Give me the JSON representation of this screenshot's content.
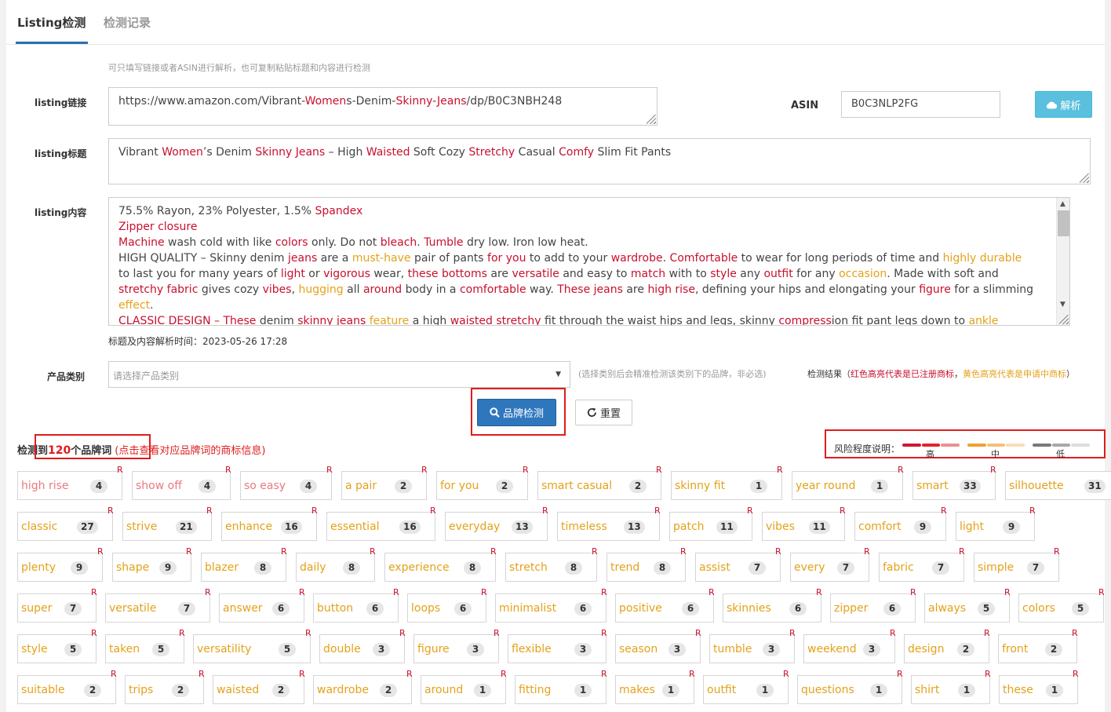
{
  "tabs": [
    "Listing检测",
    "检测记录"
  ],
  "hint": "可只填写链接或者ASIN进行解析，也可复制粘贴标题和内容进行检测",
  "link": {
    "label": "listing链接",
    "parts": [
      {
        "t": "https://www.amazon.com/Vibrant-",
        "c": ""
      },
      {
        "t": "Women",
        "c": "r"
      },
      {
        "t": "s-Denim-",
        "c": ""
      },
      {
        "t": "Skinny-Jeans",
        "c": "r"
      },
      {
        "t": "/dp/B0C3NBH248",
        "c": ""
      }
    ]
  },
  "asin": {
    "label": "ASIN",
    "value": "B0C3NLP2FG",
    "parse_button": "解析"
  },
  "title": {
    "label": "listing标题",
    "parts": [
      {
        "t": "Vibrant ",
        "c": ""
      },
      {
        "t": "Women",
        "c": "r"
      },
      {
        "t": "’s Denim ",
        "c": ""
      },
      {
        "t": "Skinny Jeans",
        "c": "r"
      },
      {
        "t": " – High ",
        "c": ""
      },
      {
        "t": "Waisted",
        "c": "r"
      },
      {
        "t": " Soft Cozy ",
        "c": ""
      },
      {
        "t": "Stretchy",
        "c": "r"
      },
      {
        "t": " Casual ",
        "c": ""
      },
      {
        "t": "Comfy",
        "c": "r"
      },
      {
        "t": " Slim Fit Pants",
        "c": ""
      }
    ]
  },
  "content": {
    "label": "listing内容",
    "lines": [
      [
        {
          "t": "75.5% Rayon, 23% Polyester, 1.5% ",
          "c": ""
        },
        {
          "t": "Spandex",
          "c": "r"
        }
      ],
      [
        {
          "t": "Zipper closure",
          "c": "r"
        }
      ],
      [
        {
          "t": "Machine",
          "c": "r"
        },
        {
          "t": " wash cold with like ",
          "c": ""
        },
        {
          "t": "colors",
          "c": "r"
        },
        {
          "t": " only. Do not ",
          "c": ""
        },
        {
          "t": "bleach",
          "c": "r"
        },
        {
          "t": ". ",
          "c": ""
        },
        {
          "t": "Tumble",
          "c": "r"
        },
        {
          "t": " dry low. Iron low heat.",
          "c": ""
        }
      ],
      [
        {
          "t": "HIGH QUALITY – Skinny denim ",
          "c": ""
        },
        {
          "t": "jeans",
          "c": "r"
        },
        {
          "t": " are a ",
          "c": ""
        },
        {
          "t": "must-have",
          "c": "o"
        },
        {
          "t": " pair of pants ",
          "c": ""
        },
        {
          "t": "for you",
          "c": "r"
        },
        {
          "t": " to add to your ",
          "c": ""
        },
        {
          "t": "wardrobe",
          "c": "r"
        },
        {
          "t": ". ",
          "c": ""
        },
        {
          "t": "Comfortable",
          "c": "r"
        },
        {
          "t": " to wear for long periods of time and ",
          "c": ""
        },
        {
          "t": "highly durable",
          "c": "o"
        }
      ],
      [
        {
          "t": "to last you for many years of ",
          "c": ""
        },
        {
          "t": "light",
          "c": "r"
        },
        {
          "t": " or ",
          "c": ""
        },
        {
          "t": "vigorous",
          "c": "r"
        },
        {
          "t": " wear, ",
          "c": ""
        },
        {
          "t": "these bottoms",
          "c": "r"
        },
        {
          "t": " are ",
          "c": ""
        },
        {
          "t": "versatile",
          "c": "r"
        },
        {
          "t": " and easy to ",
          "c": ""
        },
        {
          "t": "match",
          "c": "r"
        },
        {
          "t": " with to ",
          "c": ""
        },
        {
          "t": "style",
          "c": "r"
        },
        {
          "t": " any ",
          "c": ""
        },
        {
          "t": "outfit",
          "c": "r"
        },
        {
          "t": " for any ",
          "c": ""
        },
        {
          "t": "occasion",
          "c": "o"
        },
        {
          "t": ". Made with soft and",
          "c": ""
        }
      ],
      [
        {
          "t": "stretchy",
          "c": "r"
        },
        {
          "t": " ",
          "c": ""
        },
        {
          "t": "fabric",
          "c": "r"
        },
        {
          "t": " gives cozy ",
          "c": ""
        },
        {
          "t": "vibes",
          "c": "r"
        },
        {
          "t": ", ",
          "c": ""
        },
        {
          "t": "hugging",
          "c": "o"
        },
        {
          "t": " all ",
          "c": ""
        },
        {
          "t": "around",
          "c": "r"
        },
        {
          "t": " body in a ",
          "c": ""
        },
        {
          "t": "comfortable",
          "c": "r"
        },
        {
          "t": " way. ",
          "c": ""
        },
        {
          "t": "These jeans",
          "c": "r"
        },
        {
          "t": " are ",
          "c": ""
        },
        {
          "t": "high rise",
          "c": "r"
        },
        {
          "t": ", defining your hips and elongating your ",
          "c": ""
        },
        {
          "t": "figure",
          "c": "r"
        },
        {
          "t": " for a slimming",
          "c": ""
        }
      ],
      [
        {
          "t": "effect",
          "c": "o"
        },
        {
          "t": ".",
          "c": ""
        }
      ],
      [
        {
          "t": "CLASSIC DESIGN – ",
          "c": "r"
        },
        {
          "t": "These",
          "c": "r"
        },
        {
          "t": " denim ",
          "c": ""
        },
        {
          "t": "skinny jeans",
          "c": "r"
        },
        {
          "t": " ",
          "c": ""
        },
        {
          "t": "feature",
          "c": "o"
        },
        {
          "t": " a high ",
          "c": ""
        },
        {
          "t": "waisted stretchy",
          "c": "r"
        },
        {
          "t": " fit through the waist hips and legs, skinny ",
          "c": ""
        },
        {
          "t": "compress",
          "c": "r"
        },
        {
          "t": "ion fit pant legs down to ",
          "c": ""
        },
        {
          "t": "ankle",
          "c": "o"
        }
      ]
    ]
  },
  "parse_time": "标题及内容解析时间：2023-05-26 17:28",
  "category": {
    "label": "产品类别",
    "placeholder": "请选择产品类别",
    "note": "(选择类别后会精准检测该类别下的品牌，非必选)",
    "result_prefix": "检测结果（",
    "result_red": "红色高亮代表是已注册商标",
    "result_sep": "，",
    "result_yellow": "黄色高亮代表是申请中商标",
    "result_suffix": "）"
  },
  "buttons": {
    "detect": "品牌检测",
    "reset": "重置"
  },
  "summary": {
    "prefix": "检测到",
    "count": "120",
    "suffix": "个品牌词",
    "note": "(点击查看对应品牌词的商标信息)"
  },
  "risk": {
    "label": "风险程度说明：",
    "high": "高",
    "mid": "中",
    "low": "低"
  },
  "colors": {
    "red": "#c8102e",
    "orange": "#e3a21a",
    "blue_btn": "#2f77bd",
    "cyan_btn": "#5bc0de"
  },
  "chips": [
    [
      {
        "w": "high rise",
        "n": "4"
      },
      {
        "w": "show off",
        "n": "4"
      },
      {
        "w": "so easy",
        "n": "4"
      },
      {
        "w": "a pair",
        "n": "2"
      },
      {
        "w": "for you",
        "n": "2"
      },
      {
        "w": "smart casual",
        "n": "2"
      },
      {
        "w": "skinny fit",
        "n": "1"
      },
      {
        "w": "year round",
        "n": "1"
      },
      {
        "w": "smart",
        "n": "33"
      },
      {
        "w": "silhouette",
        "n": "31"
      }
    ],
    [
      {
        "w": "classic",
        "n": "27"
      },
      {
        "w": "strive",
        "n": "21"
      },
      {
        "w": "enhance",
        "n": "16"
      },
      {
        "w": "essential",
        "n": "16"
      },
      {
        "w": "everyday",
        "n": "13"
      },
      {
        "w": "timeless",
        "n": "13"
      },
      {
        "w": "patch",
        "n": "11"
      },
      {
        "w": "vibes",
        "n": "11"
      },
      {
        "w": "comfort",
        "n": "9"
      },
      {
        "w": "light",
        "n": "9"
      }
    ],
    [
      {
        "w": "plenty",
        "n": "9"
      },
      {
        "w": "shape",
        "n": "9"
      },
      {
        "w": "blazer",
        "n": "8"
      },
      {
        "w": "daily",
        "n": "8"
      },
      {
        "w": "experience",
        "n": "8"
      },
      {
        "w": "stretch",
        "n": "8"
      },
      {
        "w": "trend",
        "n": "8"
      },
      {
        "w": "assist",
        "n": "7"
      },
      {
        "w": "every",
        "n": "7"
      },
      {
        "w": "fabric",
        "n": "7"
      },
      {
        "w": "simple",
        "n": "7"
      }
    ],
    [
      {
        "w": "super",
        "n": "7"
      },
      {
        "w": "versatile",
        "n": "7"
      },
      {
        "w": "answer",
        "n": "6"
      },
      {
        "w": "button",
        "n": "6"
      },
      {
        "w": "loops",
        "n": "6"
      },
      {
        "w": "minimalist",
        "n": "6"
      },
      {
        "w": "positive",
        "n": "6"
      },
      {
        "w": "skinnies",
        "n": "6"
      },
      {
        "w": "zipper",
        "n": "6"
      },
      {
        "w": "always",
        "n": "5"
      },
      {
        "w": "colors",
        "n": "5"
      }
    ],
    [
      {
        "w": "style",
        "n": "5"
      },
      {
        "w": "taken",
        "n": "5"
      },
      {
        "w": "versatility",
        "n": "5"
      },
      {
        "w": "double",
        "n": "3"
      },
      {
        "w": "figure",
        "n": "3"
      },
      {
        "w": "flexible",
        "n": "3"
      },
      {
        "w": "season",
        "n": "3"
      },
      {
        "w": "tumble",
        "n": "3"
      },
      {
        "w": "weekend",
        "n": "3"
      },
      {
        "w": "design",
        "n": "2"
      },
      {
        "w": "front",
        "n": "2"
      }
    ],
    [
      {
        "w": "suitable",
        "n": "2"
      },
      {
        "w": "trips",
        "n": "2"
      },
      {
        "w": "waisted",
        "n": "2"
      },
      {
        "w": "wardrobe",
        "n": "2"
      },
      {
        "w": "around",
        "n": "1"
      },
      {
        "w": "fitting",
        "n": "1"
      },
      {
        "w": "makes",
        "n": "1"
      },
      {
        "w": "outfit",
        "n": "1"
      },
      {
        "w": "questions",
        "n": "1"
      },
      {
        "w": "shirt",
        "n": "1"
      },
      {
        "w": "these",
        "n": "1"
      }
    ]
  ],
  "chip_mark": "R"
}
